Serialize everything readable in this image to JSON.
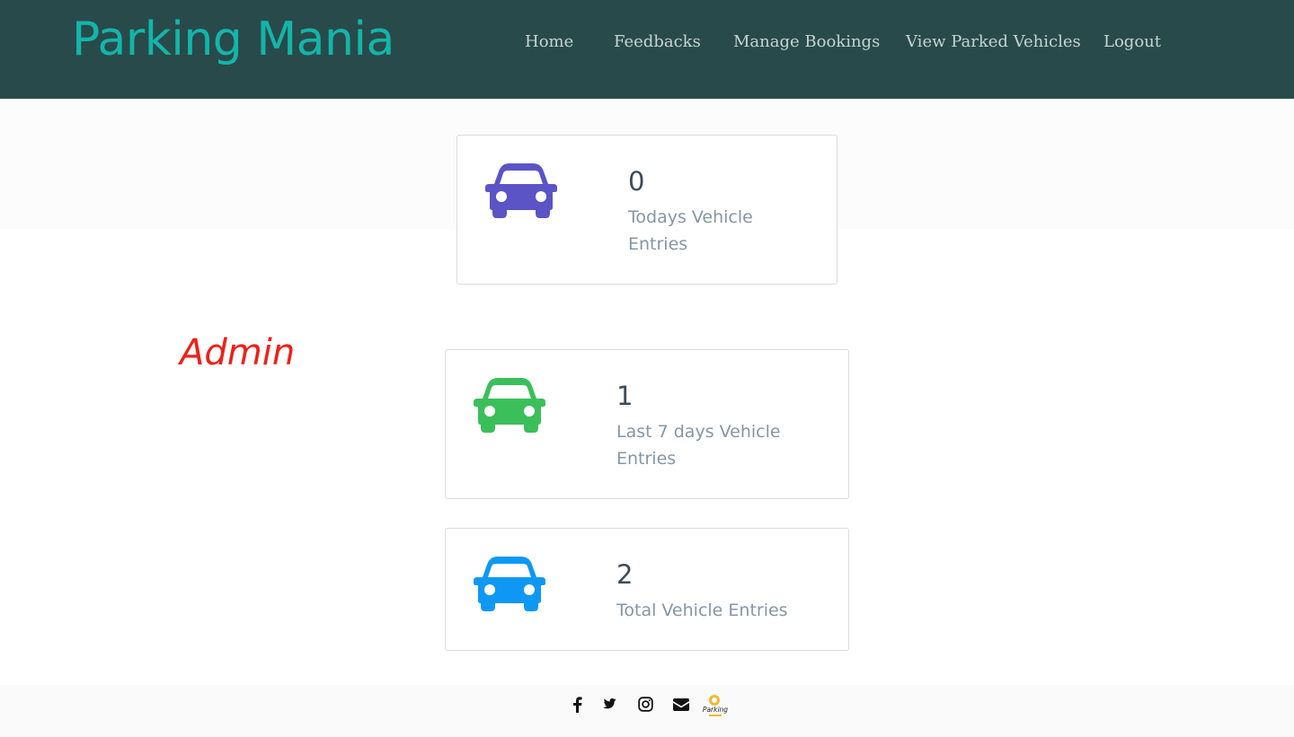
{
  "app": {
    "brand": "Parking Mania"
  },
  "nav": {
    "items": [
      {
        "label": "Home"
      },
      {
        "label": "Feedbacks"
      },
      {
        "label": "Manage Bookings"
      },
      {
        "label": "View Parked Vehicles"
      },
      {
        "label": "Logout"
      }
    ]
  },
  "stats": [
    {
      "count": "0",
      "label_line1": "Todays Vehicle",
      "label_line2": "Entries",
      "icon": "car-icon",
      "color": "#5a54c7"
    },
    {
      "count": "1",
      "label_line1": "Last 7 days Vehicle",
      "label_line2": "Entries",
      "icon": "car-icon",
      "color": "#3bbf5a"
    },
    {
      "count": "2",
      "label_line1": "Total Vehicle Entries",
      "label_line2": "",
      "icon": "car-icon",
      "color": "#0e98f4"
    }
  ],
  "role_label": "Admin",
  "footer": {
    "icons": [
      "facebook-icon",
      "twitter-icon",
      "instagram-icon",
      "envelope-icon"
    ],
    "logo_text": "Parking"
  },
  "colors": {
    "navbar": "#284a4b",
    "brand": "#14b5a9",
    "admin": "#ef2018"
  }
}
